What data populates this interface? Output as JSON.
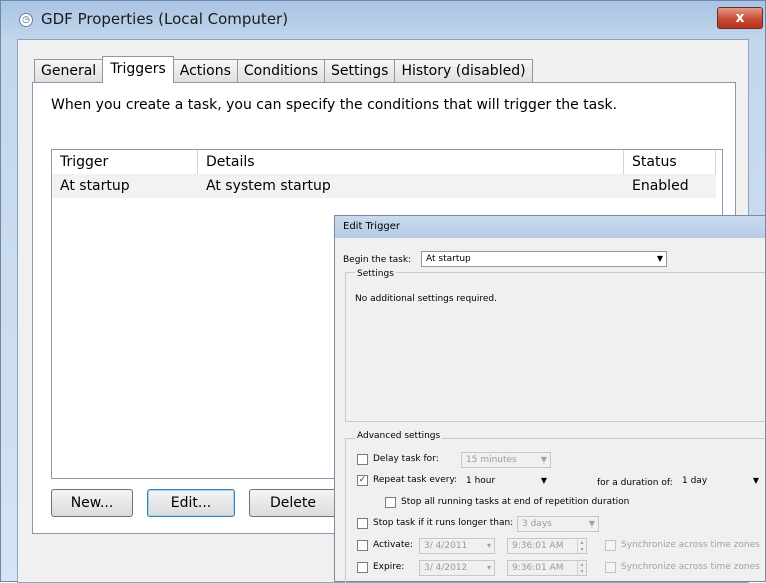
{
  "window": {
    "title": "GDF Properties (Local Computer)",
    "close_label": "x",
    "app_icon": "task-clock-icon"
  },
  "tabs": [
    "General",
    "Triggers",
    "Actions",
    "Conditions",
    "Settings",
    "History (disabled)"
  ],
  "active_tab": "Triggers",
  "triggers": {
    "description": "When you create a task, you can specify the conditions that will trigger the task.",
    "columns": [
      "Trigger",
      "Details",
      "Status"
    ],
    "rows": [
      {
        "trigger": "At startup",
        "details": "At system startup",
        "status": "Enabled"
      }
    ],
    "buttons": {
      "new": "New...",
      "edit": "Edit...",
      "delete": "Delete"
    }
  },
  "edit_trigger": {
    "title": "Edit Trigger",
    "begin_label": "Begin the task:",
    "begin_value": "At startup",
    "settings_label": "Settings",
    "settings_note": "No additional settings required.",
    "advanced_label": "Advanced settings",
    "delay_label": "Delay task for:",
    "delay_value": "15 minutes",
    "delay_checked": false,
    "repeat_label": "Repeat task every:",
    "repeat_value": "1 hour",
    "repeat_checked": true,
    "duration_label": "for a duration of:",
    "duration_value": "1 day",
    "stop_running_label": "Stop all running tasks at end of repetition duration",
    "stop_running_checked": false,
    "stop_longer_label": "Stop task if it runs longer than:",
    "stop_longer_value": "3 days",
    "stop_longer_checked": false,
    "activate_label": "Activate:",
    "activate_date": "3/ 4/2011",
    "activate_time": "9:36:01 AM",
    "expire_label": "Expire:",
    "expire_date": "3/ 4/2012",
    "expire_time": "9:36:01 AM",
    "sync_label": "Synchronize across time zones",
    "checkmark": "✓"
  }
}
